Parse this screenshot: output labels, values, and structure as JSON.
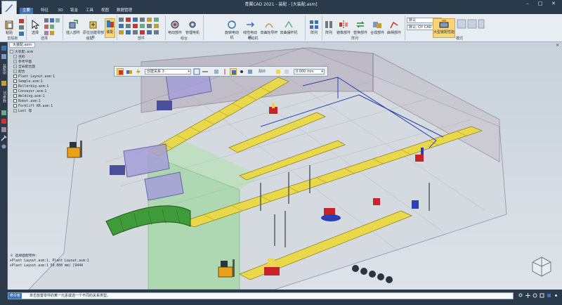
{
  "window": {
    "title": "青翼CAD 2021 - 装配 - [大装配.asm]",
    "controls": [
      "–",
      "□",
      "✕"
    ]
  },
  "menu": {
    "tabs": [
      {
        "label": "主要",
        "active": true
      },
      {
        "label": "特征",
        "active": false
      },
      {
        "label": "3D",
        "active": false
      },
      {
        "label": "钣金",
        "active": false
      },
      {
        "label": "工具",
        "active": false
      },
      {
        "label": "视图",
        "active": false
      },
      {
        "label": "数据管理",
        "active": false
      }
    ]
  },
  "ribbon": {
    "clipboard": {
      "paste": "粘贴",
      "group": "剪贴板"
    },
    "select": {
      "label": "选择",
      "group": "选择"
    },
    "assembly": {
      "insert_part": "插入部件",
      "new_part": "原位创建零部件",
      "assemble": "装配",
      "group": "装配"
    },
    "parts": {
      "label": "部件",
      "group": "部件"
    },
    "combine": {
      "motor": "电动部件",
      "manage": "管理电机",
      "group": "组合"
    },
    "motors": {
      "rotary": "旋转电动机",
      "linear": "线性电动机",
      "swing": "双曲轮导杆",
      "more": "双曲摆杆机",
      "group": "电动机"
    },
    "array": {
      "label": "阵列",
      "group": "阵列"
    },
    "deform": {
      "array": "阵列",
      "mirror": "镜像部件",
      "replace": "替换部件",
      "merge": "合成部件",
      "crank": "曲柄部件",
      "group": "阵列"
    },
    "combo1": {
      "value": "默认"
    },
    "combo2": {
      "value": "默认, QY CAD"
    },
    "mode": {
      "big_asm": "大型装配性能",
      "group": "模式"
    }
  },
  "left_toolbar": {
    "label1": "装配树",
    "label2": "3D参数"
  },
  "doc_tab": {
    "label": "大装配.asm",
    "close": "×"
  },
  "tree": {
    "rows": [
      {
        "text": "大装配.asm",
        "indent": 0,
        "kind": "root"
      },
      {
        "text": "坐标",
        "indent": 1,
        "kind": "exp"
      },
      {
        "text": "参考平面",
        "indent": 1,
        "kind": "exp"
      },
      {
        "text": "全局配合面",
        "indent": 1,
        "kind": "exp"
      },
      {
        "text": "配合",
        "indent": 1,
        "kind": "exp"
      },
      {
        "text": "Plant Layout.asm:1",
        "indent": 1,
        "kind": "chk"
      },
      {
        "text": "Sample.asm:1",
        "indent": 1,
        "kind": "chk"
      },
      {
        "text": "Rollerbig.asm:1",
        "indent": 1,
        "kind": "chk"
      },
      {
        "text": "Conveyor.asm:1",
        "indent": 1,
        "kind": "chk"
      },
      {
        "text": "Welding.asm:1",
        "indent": 1,
        "kind": "chk"
      },
      {
        "text": "Robot.asm:1",
        "indent": 1,
        "kind": "chk"
      },
      {
        "text": "Forklift KR.asm:1",
        "indent": 1,
        "kind": "chk"
      },
      {
        "text": "Last 等",
        "indent": 1,
        "kind": "exp"
      }
    ]
  },
  "float_toolbar": {
    "relation": "创建关系 3",
    "flip": "翻转",
    "offset": "0.000 mm"
  },
  "info_box": {
    "line1": "※ 选择面配零件：",
    "line2": "⊳Plant Layout.asm:1, Plant Layout.asm:1",
    "line3": "⊳Plant Layout.asm:1   50.000 mm)   [9444"
  },
  "statusbar": {
    "button": "命令条",
    "text": "单击放置零件的某一元素或选一个不同的关系类型。"
  },
  "colors": {
    "accent": "#3a74b5",
    "selected": "#f9d57a",
    "conveyor_yellow": "#e8d84a",
    "frame_blue": "#2a3fb4",
    "robot_red": "#c8232a",
    "zone_green": "#7fd67a",
    "truck_lilac": "#a59fd9"
  }
}
